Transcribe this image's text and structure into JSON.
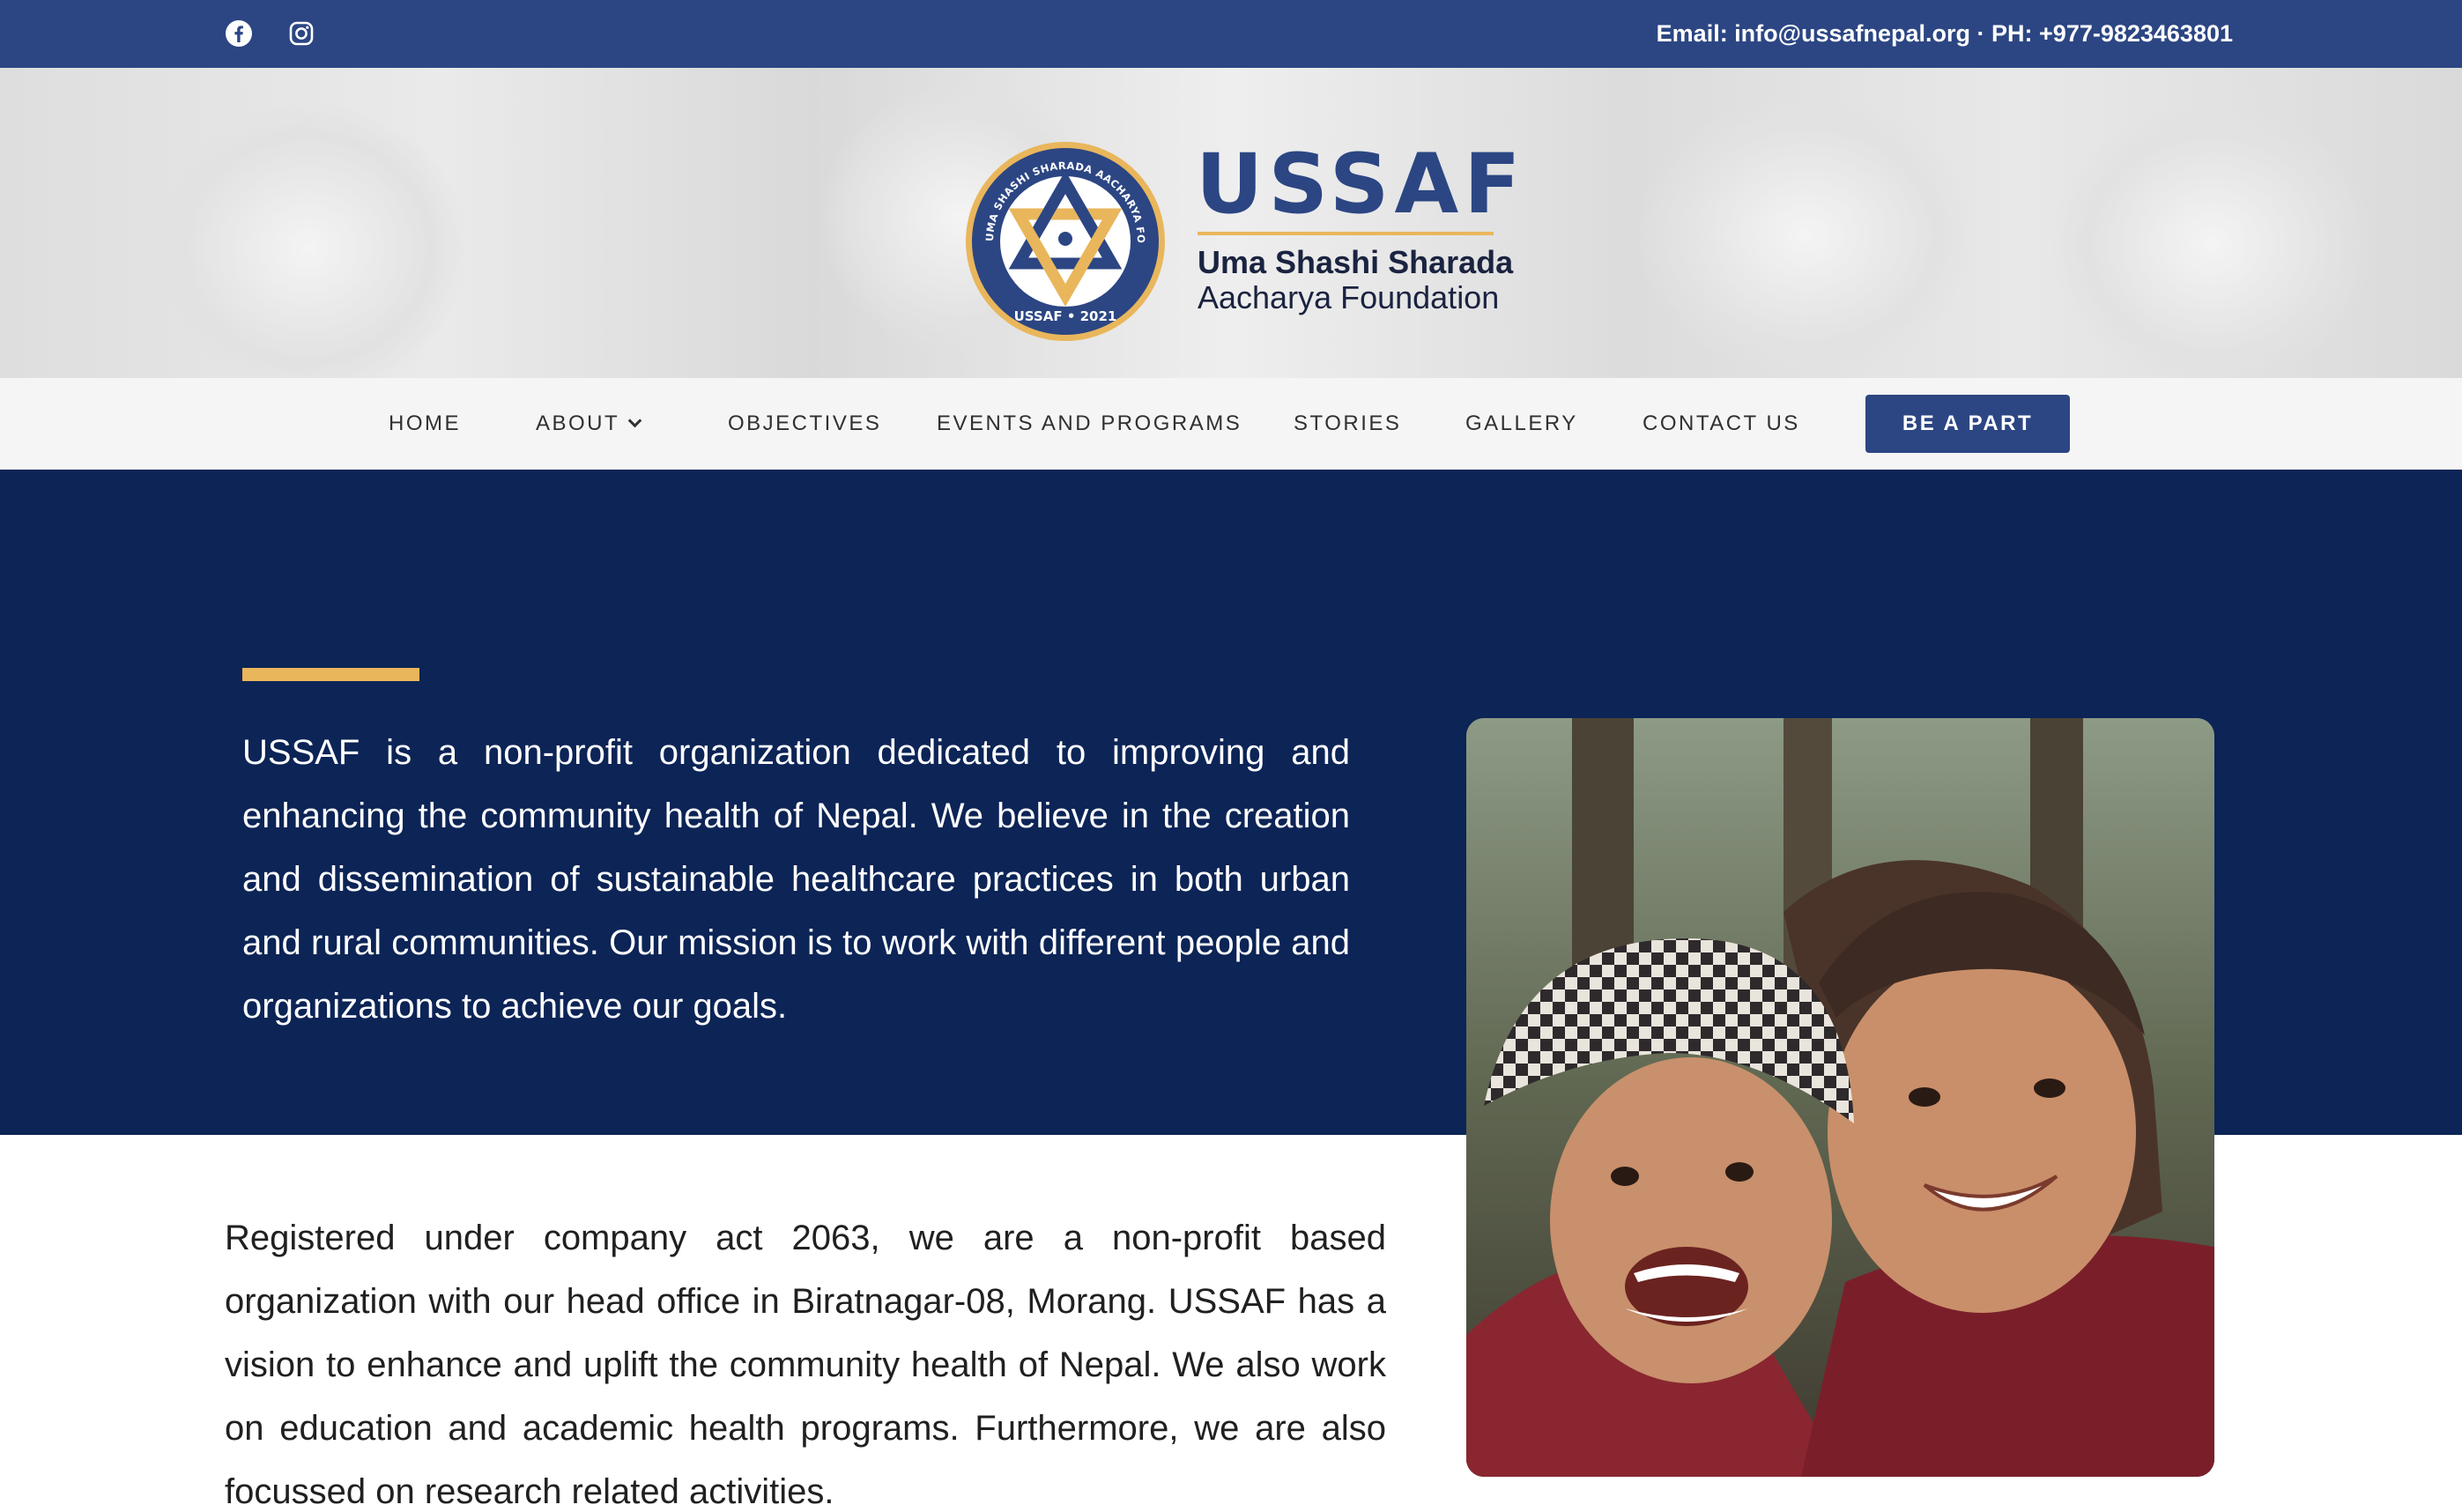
{
  "topbar": {
    "icons": [
      "facebook-icon",
      "instagram-icon"
    ],
    "contact": "Email: info@ussafnepal.org · PH: +977-9823463801"
  },
  "logo": {
    "title": "USSAF",
    "subtitle_line1": "Uma Shashi Sharada",
    "subtitle_line2": "Aacharya Foundation",
    "seal_ring_text": "UMA SHASHI SHARADA AACHARYA FOUNDATION",
    "seal_bottom_text": "USSAF • 2021"
  },
  "nav": {
    "items": [
      "HOME",
      "ABOUT",
      "OBJECTIVES",
      "EVENTS AND PROGRAMS",
      "STORIES",
      "GALLERY",
      "CONTACT US"
    ],
    "cta": "BE A PART"
  },
  "hero": {
    "text": "USSAF is a non-profit organization dedicated to improving and enhancing the community health of Nepal. We believe in the creation and dissemination of sustainable healthcare practices in both urban and rural communities. Our mission is to work with different people and organizations to achieve our goals."
  },
  "about": {
    "text": "Registered under company act 2063, we are a non-profit based organization with our head office in Biratnagar-08, Morang. USSAF has a vision to enhance and uplift the community health of Nepal. We also work on education and academic health programs. Furthermore, we are also focussed on research related activities."
  },
  "colors": {
    "primary": "#2c4683",
    "hero_bg": "#0c2456",
    "accent": "#e9b65c"
  }
}
